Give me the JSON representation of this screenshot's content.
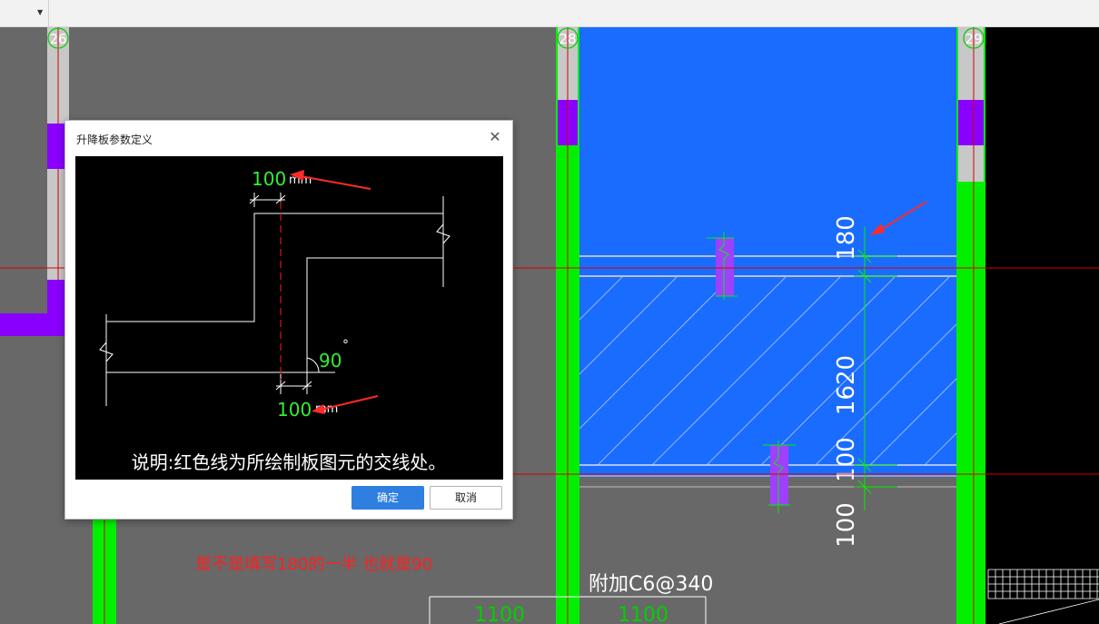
{
  "toolbar": {
    "dropdown_icon": "caret-down-icon"
  },
  "grid": {
    "axis_26": "26",
    "axis_28": "28",
    "axis_29": "29"
  },
  "drawing": {
    "dim_180": "180",
    "dim_1620": "1620",
    "dim_100_mid": "100",
    "dim_100_low": "100",
    "rebar_label": "附加C6@340",
    "span_left": "1100",
    "span_right": "1100",
    "annotation": "是不是填写180的一半 也就是90"
  },
  "dialog": {
    "title": "升降板参数定义",
    "close_icon": "close-icon",
    "preview": {
      "top_value": "100",
      "top_unit": "mm",
      "angle_value": "90",
      "angle_unit": "°",
      "bottom_value": "100",
      "bottom_unit": "mm",
      "note": "说明:红色线为所绘制板图元的交线处。"
    },
    "ok_label": "确定",
    "cancel_label": "取消"
  },
  "colors": {
    "background": "#686868",
    "slab_blue": "#1a6cff",
    "wall_green": "#00f000",
    "column_purple": "#8a00ff",
    "axis_red": "#d80000",
    "dialog_accent": "#2e7fe0"
  }
}
